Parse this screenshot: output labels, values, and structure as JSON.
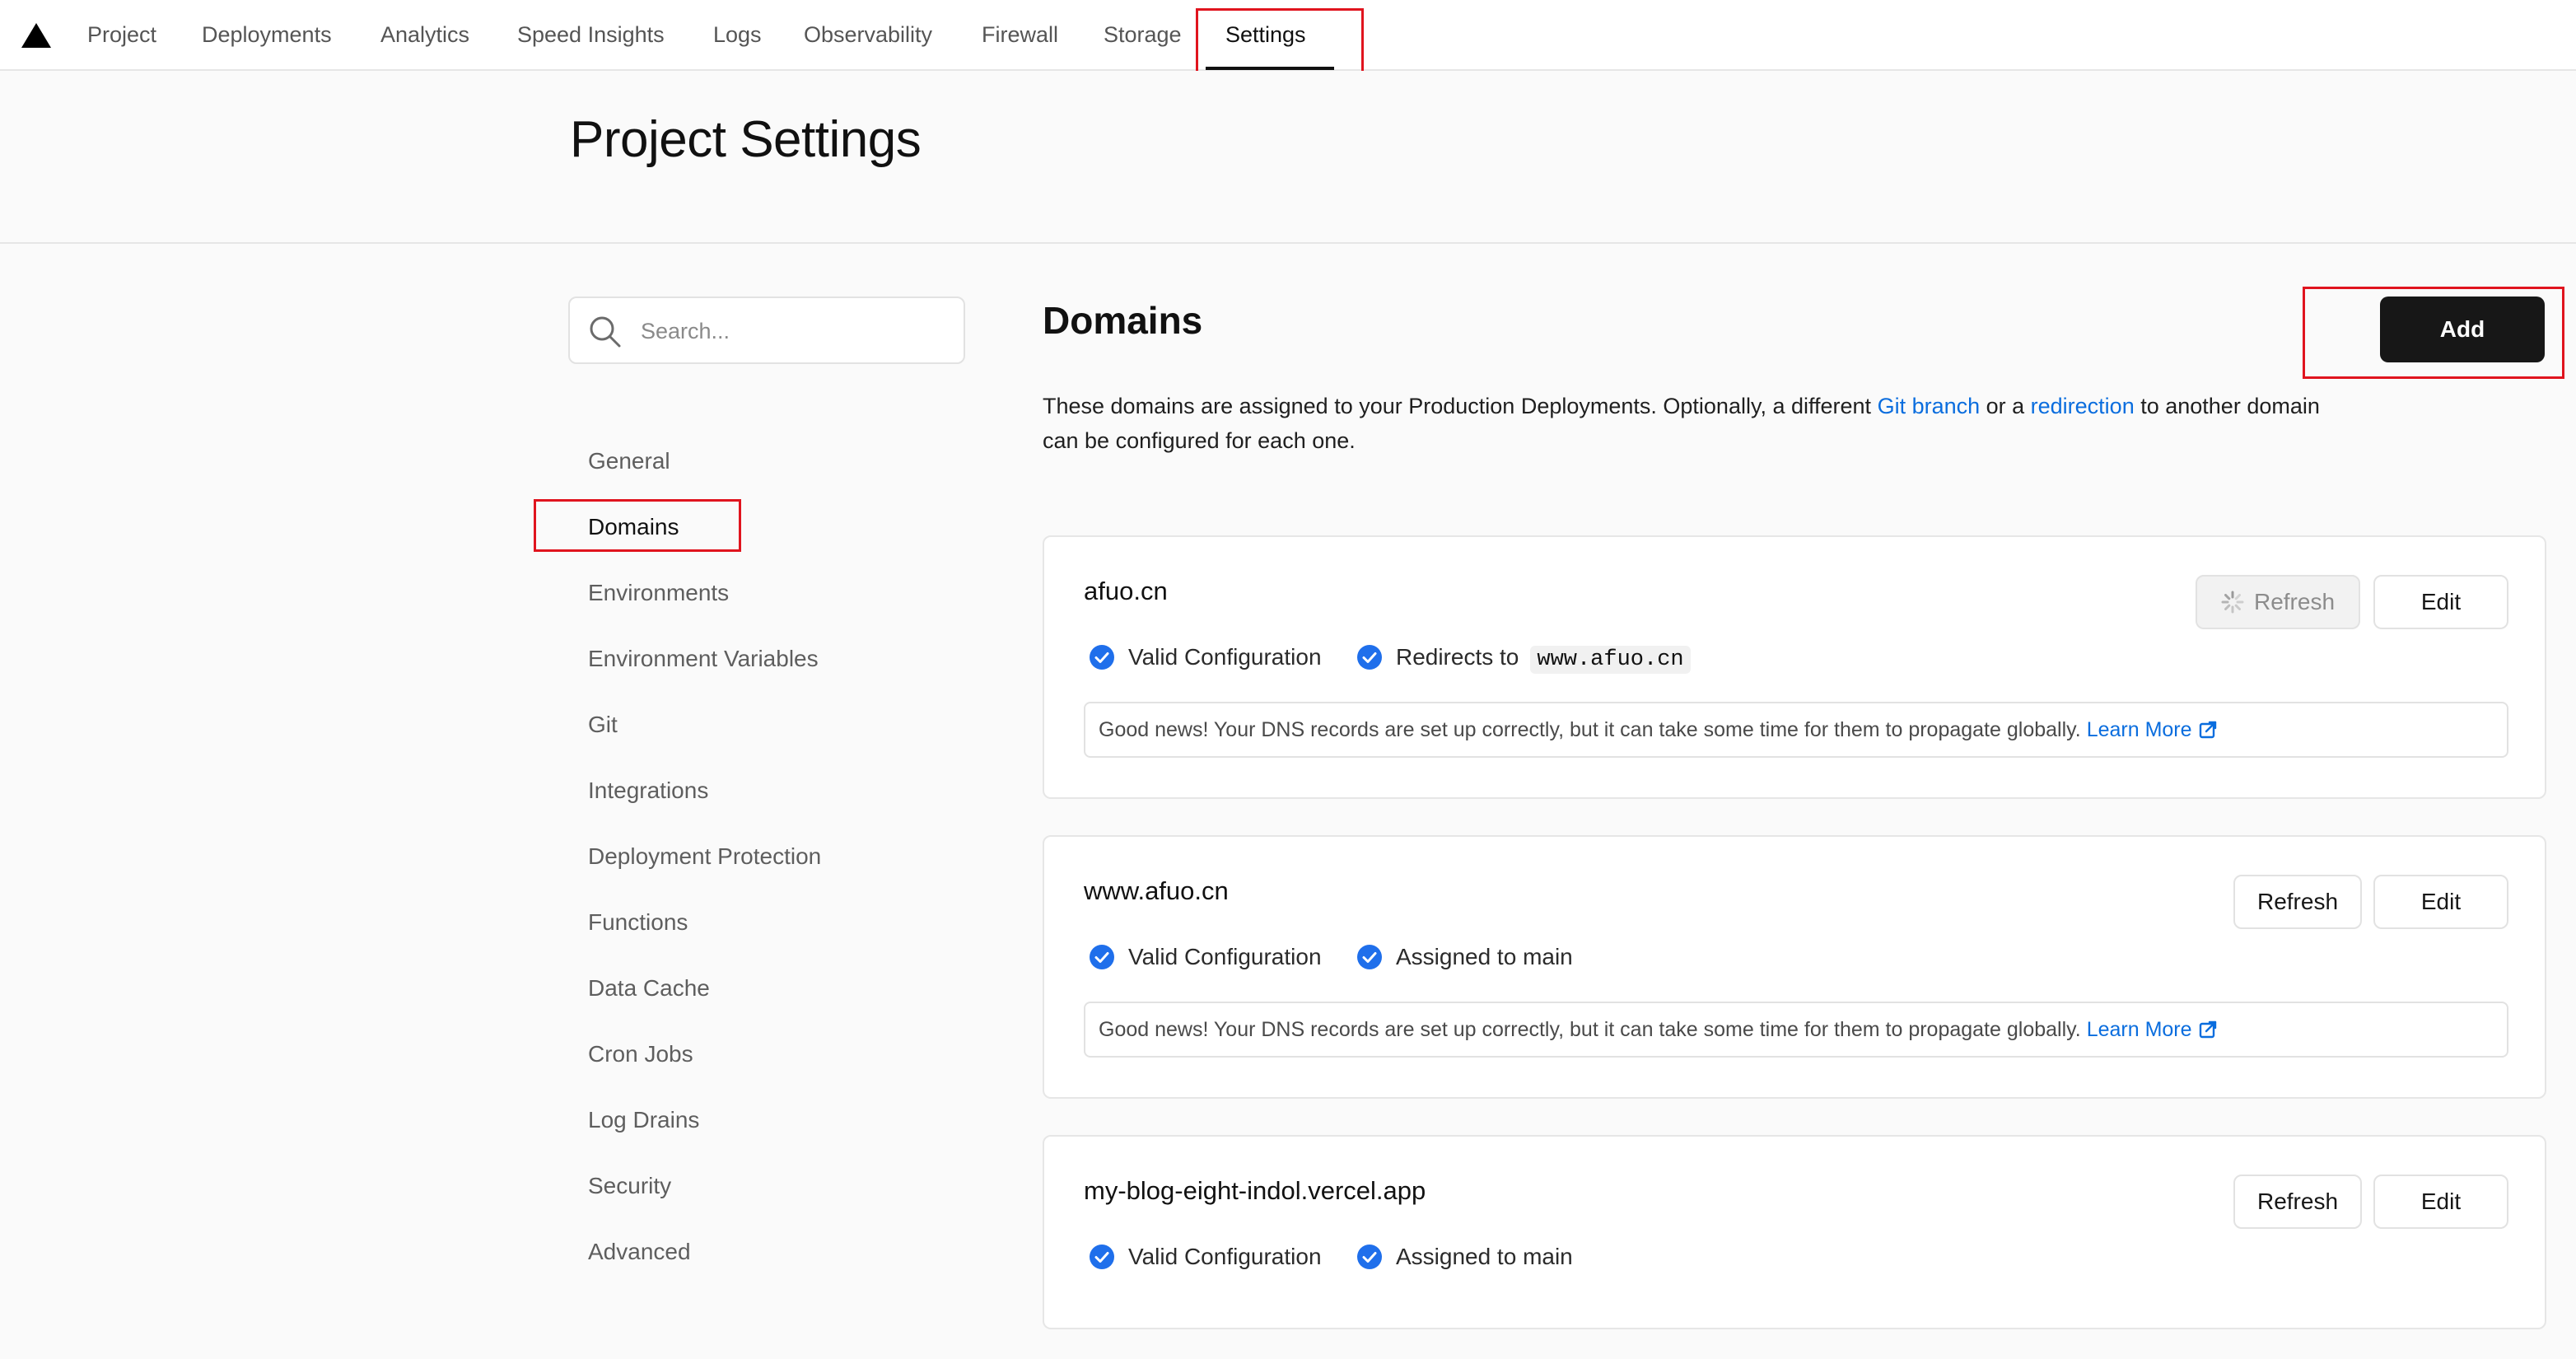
{
  "topnav": {
    "items": [
      "Project",
      "Deployments",
      "Analytics",
      "Speed Insights",
      "Logs",
      "Observability",
      "Firewall",
      "Storage",
      "Settings"
    ],
    "active": "Settings"
  },
  "page": {
    "title": "Project Settings"
  },
  "sidebar": {
    "search_placeholder": "Search...",
    "items": [
      "General",
      "Domains",
      "Environments",
      "Environment Variables",
      "Git",
      "Integrations",
      "Deployment Protection",
      "Functions",
      "Data Cache",
      "Cron Jobs",
      "Log Drains",
      "Security",
      "Advanced"
    ],
    "active": "Domains"
  },
  "domains": {
    "title": "Domains",
    "add_label": "Add",
    "description_parts": {
      "before": "These domains are assigned to your Production Deployments. Optionally, a different ",
      "link1": "Git branch",
      "middle": " or a ",
      "link2": "redirection",
      "after": " to another domain can be configured for each one."
    },
    "cards": [
      {
        "name": "afuo.cn",
        "refresh_label": "Refresh",
        "refresh_loading": true,
        "edit_label": "Edit",
        "status1": "Valid Configuration",
        "status2": "Redirects to",
        "redirect_target": "www.afuo.cn",
        "note": "Good news! Your DNS records are set up correctly, but it can take some time for them to propagate globally.",
        "learn_more": "Learn More"
      },
      {
        "name": "www.afuo.cn",
        "refresh_label": "Refresh",
        "refresh_loading": false,
        "edit_label": "Edit",
        "status1": "Valid Configuration",
        "status2": "Assigned to main",
        "note": "Good news! Your DNS records are set up correctly, but it can take some time for them to propagate globally.",
        "learn_more": "Learn More"
      },
      {
        "name": "my-blog-eight-indol.vercel.app",
        "refresh_label": "Refresh",
        "refresh_loading": false,
        "edit_label": "Edit",
        "status1": "Valid Configuration",
        "status2": "Assigned to main"
      }
    ]
  },
  "colors": {
    "accent_link": "#0a6dde",
    "check_blue": "#1f6feb",
    "highlight_red": "#e0141e",
    "primary_button": "#171717"
  },
  "icons": [
    "vercel-logo-icon",
    "search-icon",
    "check-circle-icon",
    "spinner-icon",
    "external-link-icon"
  ]
}
